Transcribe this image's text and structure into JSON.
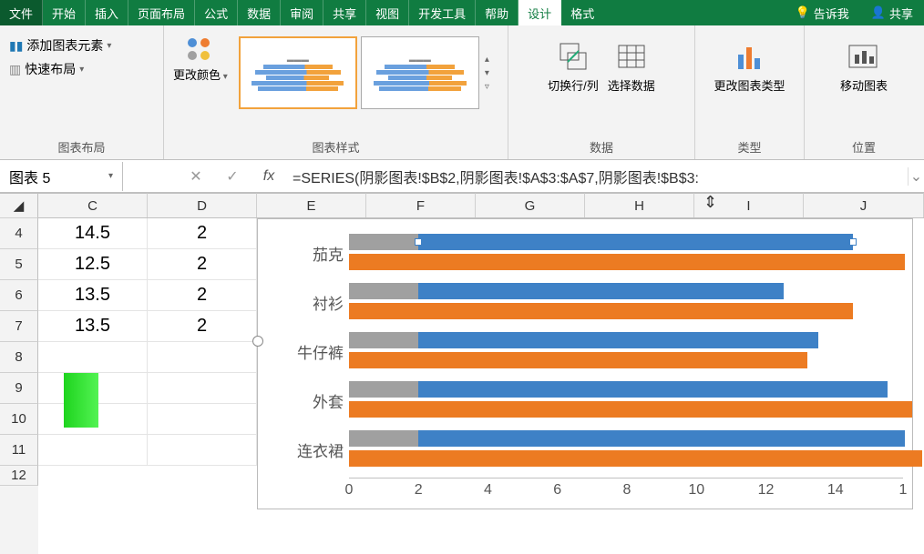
{
  "tabs": {
    "file": "文件",
    "home": "开始",
    "insert": "插入",
    "pagelayout": "页面布局",
    "formulas": "公式",
    "data": "数据",
    "review": "审阅",
    "share_tab": "共享",
    "view": "视图",
    "dev": "开发工具",
    "help": "帮助",
    "design": "设计",
    "format": "格式",
    "tellme": "告诉我",
    "share": "共享"
  },
  "ribbon": {
    "add_chart_elem": "添加图表元素",
    "quick_layout": "快速布局",
    "group_layout": "图表布局",
    "change_colors": "更改颜色",
    "group_styles": "图表样式",
    "switch": "切换行/列",
    "select_data": "选择数据",
    "group_data": "数据",
    "change_type": "更改图表类型",
    "group_type": "类型",
    "move_chart": "移动图表",
    "group_location": "位置"
  },
  "namebox": "图表 5",
  "formula": "=SERIES(阴影图表!$B$2,阴影图表!$A$3:$A$7,阴影图表!$B$3:",
  "columns": [
    "C",
    "D",
    "E",
    "F",
    "G",
    "H",
    "I",
    "J"
  ],
  "rows": [
    "4",
    "5",
    "6",
    "7",
    "8",
    "9",
    "10",
    "11",
    "12"
  ],
  "cells": {
    "c4": "14.5",
    "d4": "2",
    "c5": "12.5",
    "d5": "2",
    "c6": "13.5",
    "d6": "2",
    "c7": "13.5",
    "d7": "2"
  },
  "chart_data": {
    "type": "bar",
    "categories": [
      "茄克",
      "衬衫",
      "牛仔裤",
      "外套",
      "连衣裙"
    ],
    "xlim": [
      0,
      16
    ],
    "xticks": [
      0,
      2,
      4,
      6,
      8,
      10,
      12,
      14
    ],
    "series": [
      {
        "name": "gray",
        "color": "#a0a0a0",
        "values": [
          2,
          2,
          2,
          2,
          2
        ]
      },
      {
        "name": "blue",
        "color": "#3e81c6",
        "values": [
          14.5,
          12.5,
          13.5,
          15.5,
          16.0
        ]
      },
      {
        "name": "orange",
        "color": "#ec7b22",
        "values": [
          16.0,
          14.5,
          13.2,
          16.2,
          16.5
        ]
      }
    ]
  }
}
